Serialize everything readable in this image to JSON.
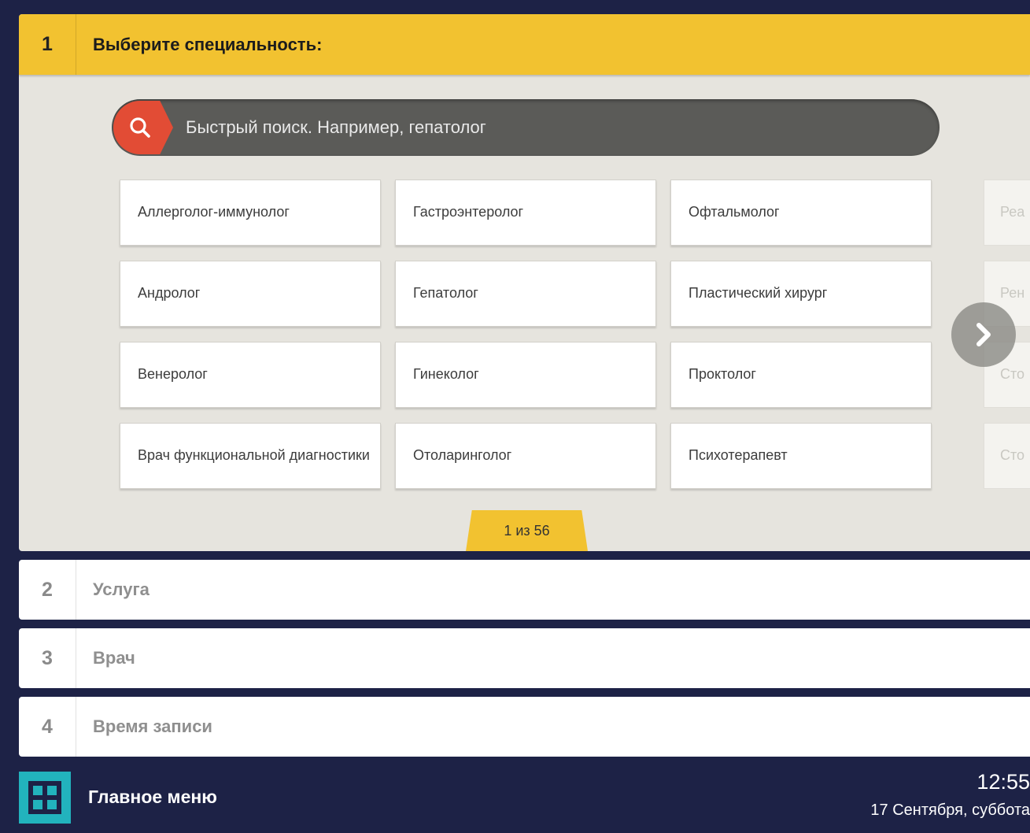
{
  "steps": [
    {
      "number": "1",
      "title": "Выберите специальность:"
    },
    {
      "number": "2",
      "title": "Услуга"
    },
    {
      "number": "3",
      "title": "Врач"
    },
    {
      "number": "4",
      "title": "Время записи"
    }
  ],
  "search": {
    "placeholder": "Быстрый поиск. Например, гепатолог",
    "icon": "search-icon"
  },
  "specialties": {
    "col1": [
      "Аллерголог-иммунолог",
      "Андролог",
      "Венеролог",
      "Врач функциональной диагностики"
    ],
    "col2": [
      "Гастроэнтеролог",
      "Гепатолог",
      "Гинеколог",
      "Отоларинголог"
    ],
    "col3": [
      "Офтальмолог",
      "Пластический хирург",
      "Проктолог",
      "Психотерапевт"
    ],
    "next_page_partial": [
      "Реа",
      "Рен",
      "Сто",
      "Сто"
    ]
  },
  "pagination": {
    "label": "1 из 56",
    "next_icon": "chevron-right-icon"
  },
  "footer": {
    "menu_label": "Главное меню",
    "menu_icon": "grid-menu-icon",
    "time": "12:55",
    "date": "17 Сентября, суббота"
  },
  "colors": {
    "background": "#1d2246",
    "accent": "#f2c230",
    "search_button": "#e24c35",
    "menu_icon": "#22b3bd"
  }
}
